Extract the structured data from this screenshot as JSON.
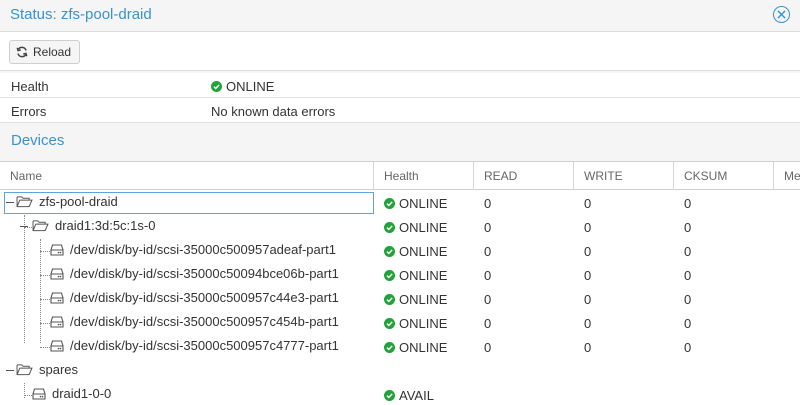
{
  "window": {
    "title": "Status: zfs-pool-draid"
  },
  "toolbar": {
    "reload_label": "Reload"
  },
  "status": {
    "health_label": "Health",
    "health_value": "ONLINE",
    "errors_label": "Errors",
    "errors_value": "No known data errors"
  },
  "devices": {
    "title": "Devices",
    "columns": {
      "name": "Name",
      "health": "Health",
      "read": "READ",
      "write": "WRITE",
      "cksum": "CKSUM",
      "msg": "Me"
    },
    "rows": [
      {
        "name": "zfs-pool-draid",
        "health": "ONLINE",
        "read": "0",
        "write": "0",
        "cksum": "0"
      },
      {
        "name": "draid1:3d:5c:1s-0",
        "health": "ONLINE",
        "read": "0",
        "write": "0",
        "cksum": "0"
      },
      {
        "name": "/dev/disk/by-id/scsi-35000c500957adeaf-part1",
        "health": "ONLINE",
        "read": "0",
        "write": "0",
        "cksum": "0"
      },
      {
        "name": "/dev/disk/by-id/scsi-35000c50094bce06b-part1",
        "health": "ONLINE",
        "read": "0",
        "write": "0",
        "cksum": "0"
      },
      {
        "name": "/dev/disk/by-id/scsi-35000c500957c44e3-part1",
        "health": "ONLINE",
        "read": "0",
        "write": "0",
        "cksum": "0"
      },
      {
        "name": "/dev/disk/by-id/scsi-35000c500957c454b-part1",
        "health": "ONLINE",
        "read": "0",
        "write": "0",
        "cksum": "0"
      },
      {
        "name": "/dev/disk/by-id/scsi-35000c500957c4777-part1",
        "health": "ONLINE",
        "read": "0",
        "write": "0",
        "cksum": "0"
      },
      {
        "name": "spares",
        "health": "",
        "read": "",
        "write": "",
        "cksum": ""
      },
      {
        "name": "draid1-0-0",
        "health": "AVAIL",
        "read": "",
        "write": "",
        "cksum": ""
      }
    ]
  },
  "colors": {
    "accent": "#3892d4",
    "ok": "#21a339"
  }
}
